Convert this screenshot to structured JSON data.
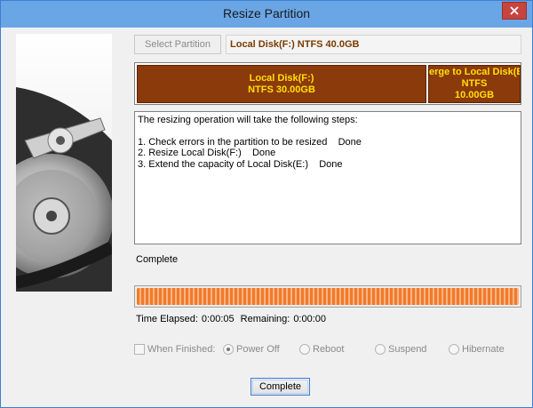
{
  "window": {
    "title": "Resize Partition"
  },
  "toolbar": {
    "select_partition_label": "Select Partition",
    "partition_value": "Local Disk(F:) NTFS 40.0GB"
  },
  "disk_map": {
    "main_segment": {
      "name": "Local Disk(F:)",
      "info": "NTFS 30.00GB"
    },
    "other_segment": {
      "name": "erge to Local Disk(E",
      "fs": "NTFS",
      "size": "10.00GB"
    }
  },
  "steps": {
    "intro": "The resizing operation will take the following steps:",
    "items": [
      "1. Check errors in the partition to be resized    Done",
      "2. Resize Local Disk(F:)    Done",
      "3. Extend the capacity of Local Disk(E:)    Done"
    ]
  },
  "status": {
    "label": "Complete",
    "progress": 1.0
  },
  "time": {
    "elapsed_label": "Time Elapsed:",
    "elapsed_value": "0:00:05",
    "remaining_label": "Remaining:",
    "remaining_value": "0:00:00"
  },
  "options": {
    "when_finished_label": "When Finished:",
    "power_off": "Power Off",
    "reboot": "Reboot",
    "suspend": "Suspend",
    "hibernate": "Hibernate",
    "selected": "power_off"
  },
  "footer": {
    "complete_button": "Complete"
  },
  "colors": {
    "segment_fill": "#8b3a0c",
    "segment_text": "#ffe000",
    "progress": "#f07a2a",
    "titlebar": "#6aa6e6"
  },
  "icons": {
    "close": "close-icon",
    "side_art": "hard-disk-illustration"
  }
}
